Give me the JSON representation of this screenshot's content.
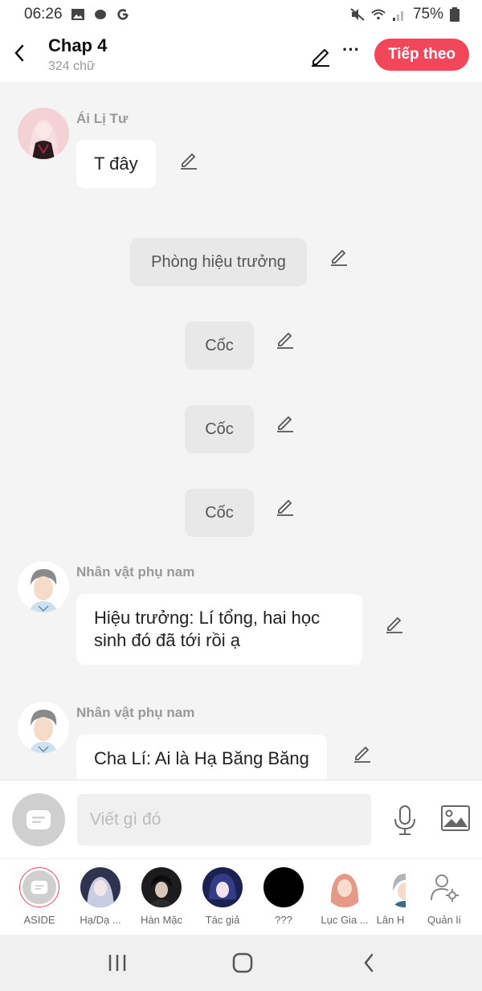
{
  "status_bar": {
    "time": "06:26",
    "battery": "75%"
  },
  "header": {
    "title": "Chap 4",
    "word_count": "324 chữ",
    "next_label": "Tiếp theo",
    "more_label": "···"
  },
  "messages": [
    {
      "speaker": "Ái Lị Tư",
      "text": "T đây"
    },
    {
      "narration": "Phòng hiệu trưởng"
    },
    {
      "narration": "Cốc"
    },
    {
      "narration": "Cốc"
    },
    {
      "narration": "Cốc"
    },
    {
      "speaker": "Nhân vật phụ nam",
      "text": "Hiệu trưởng: Lí tổng, hai học sinh đó đã tới rồi ạ"
    },
    {
      "speaker": "Nhân vật phụ nam",
      "text": "Cha Lí: Ai là Hạ Băng Băng"
    }
  ],
  "input": {
    "placeholder": "Viết gì đó"
  },
  "characters": [
    {
      "name": "ASIDE"
    },
    {
      "name": "Hạ/Dạ ..."
    },
    {
      "name": "Hàn Mặc"
    },
    {
      "name": "Tác giả"
    },
    {
      "name": "???"
    },
    {
      "name": "Lục Gia ..."
    },
    {
      "name": "Lân H"
    },
    {
      "name": "Quản lí"
    }
  ],
  "colors": {
    "accent": "#f2475b",
    "background": "#f4f4f4",
    "narration_bg": "#e8e8e8"
  }
}
